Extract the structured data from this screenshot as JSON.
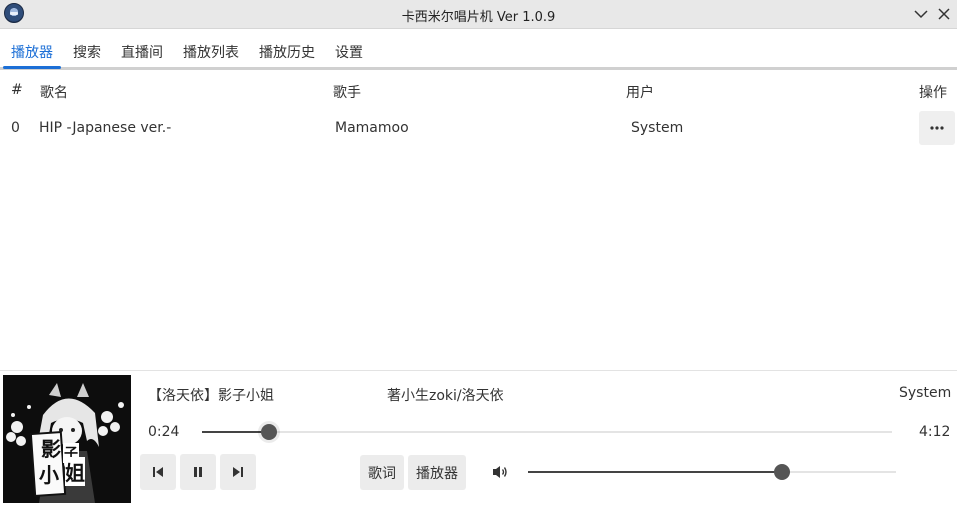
{
  "window": {
    "title": "卡西米尔唱片机 Ver 1.0.9",
    "icons": [
      "app-logo-icon",
      "chevron-down-icon",
      "close-icon"
    ]
  },
  "tabs": [
    {
      "label": "播放器",
      "active": true
    },
    {
      "label": "搜索",
      "active": false
    },
    {
      "label": "直播间",
      "active": false
    },
    {
      "label": "播放列表",
      "active": false
    },
    {
      "label": "播放历史",
      "active": false
    },
    {
      "label": "设置",
      "active": false
    }
  ],
  "table": {
    "headers": [
      "#",
      "歌名",
      "歌手",
      "用户",
      "操作"
    ],
    "rows": [
      {
        "index": "0",
        "title": "HIP -Japanese ver.-",
        "artist": "Mamamoo",
        "user": "System",
        "action_icon": "more-horizontal-icon"
      }
    ]
  },
  "player": {
    "title": "【洛天依】影子小姐",
    "artist": "著小生zoki/洛天依",
    "user": "System",
    "elapsed": "0:24",
    "duration": "4:12",
    "progress_fraction": 0.097,
    "volume_fraction": 0.69,
    "cover_text": [
      "影",
      "子",
      "小",
      "姐"
    ],
    "buttons": {
      "lyrics": "歌词",
      "player": "播放器"
    },
    "icons": [
      "skip-previous-icon",
      "pause-icon",
      "skip-next-icon",
      "volume-icon"
    ]
  },
  "colors": {
    "accent": "#1c6fd6",
    "titlebar": "#e8e8e8",
    "button_bg": "#ececec"
  }
}
